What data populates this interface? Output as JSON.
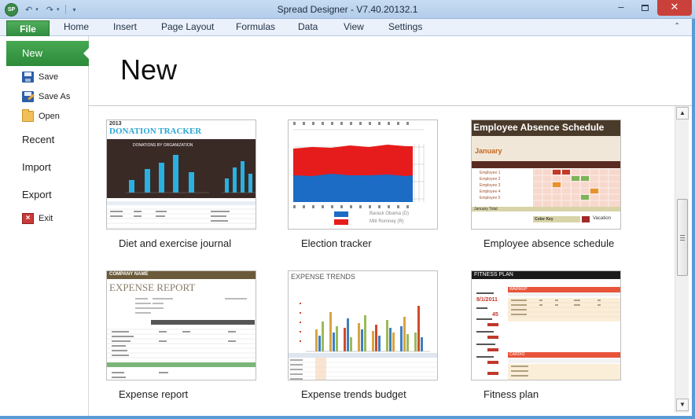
{
  "window": {
    "title": "Spread Designer - V7.40.20132.1",
    "logo_text": "SP",
    "min_glyph": "–",
    "close_glyph": "✕"
  },
  "quick_access": {
    "undo_icon": "undo-icon",
    "redo_icon": "redo-icon",
    "customize_icon": "customize-icon"
  },
  "ribbon": {
    "file": "File",
    "tabs": [
      "Home",
      "Insert",
      "Page Layout",
      "Formulas",
      "Data",
      "View",
      "Settings"
    ],
    "collapse_glyph": "⌃"
  },
  "backstage": {
    "nav": {
      "new": "New",
      "save": "Save",
      "save_as": "Save As",
      "open": "Open",
      "recent": "Recent",
      "import": "Import",
      "export": "Export",
      "exit": "Exit"
    },
    "title": "New",
    "templates": [
      {
        "label": "Diet and exercise journal"
      },
      {
        "label": "Election tracker"
      },
      {
        "label": "Employee absence schedule"
      },
      {
        "label": "Expense report"
      },
      {
        "label": "Expense trends budget"
      },
      {
        "label": "Fitness plan"
      }
    ],
    "thumbs": {
      "donation": {
        "year": "2013",
        "title": "DONATION TRACKER",
        "subtitle": "DONATIONS BY ORGANIZATION"
      },
      "election": {
        "legend1": "Barack Obama (D)",
        "legend2": "Mitt Romney (R)"
      },
      "absence": {
        "title": "Employee Absence Schedule",
        "month": "January",
        "employees": [
          "Employee 1",
          "Employee 2",
          "Employee 3",
          "Employee 4",
          "Employee 5"
        ],
        "total": "January Total",
        "key": "Color Key",
        "vacation": "Vacation"
      },
      "expense": {
        "company": "COMPANY NAME",
        "title": "EXPENSE REPORT"
      },
      "trends": {
        "title": "EXPENSE TRENDS"
      },
      "fitness": {
        "title": "FITNESS PLAN",
        "date": "8/1/2011",
        "age": "45",
        "warmup": "WARMUP",
        "cardio": "CARDIO"
      }
    }
  },
  "colors": {
    "accent_green": "#2f8a3e",
    "window_frame": "#5b9bd5",
    "close_red": "#c9413a"
  }
}
